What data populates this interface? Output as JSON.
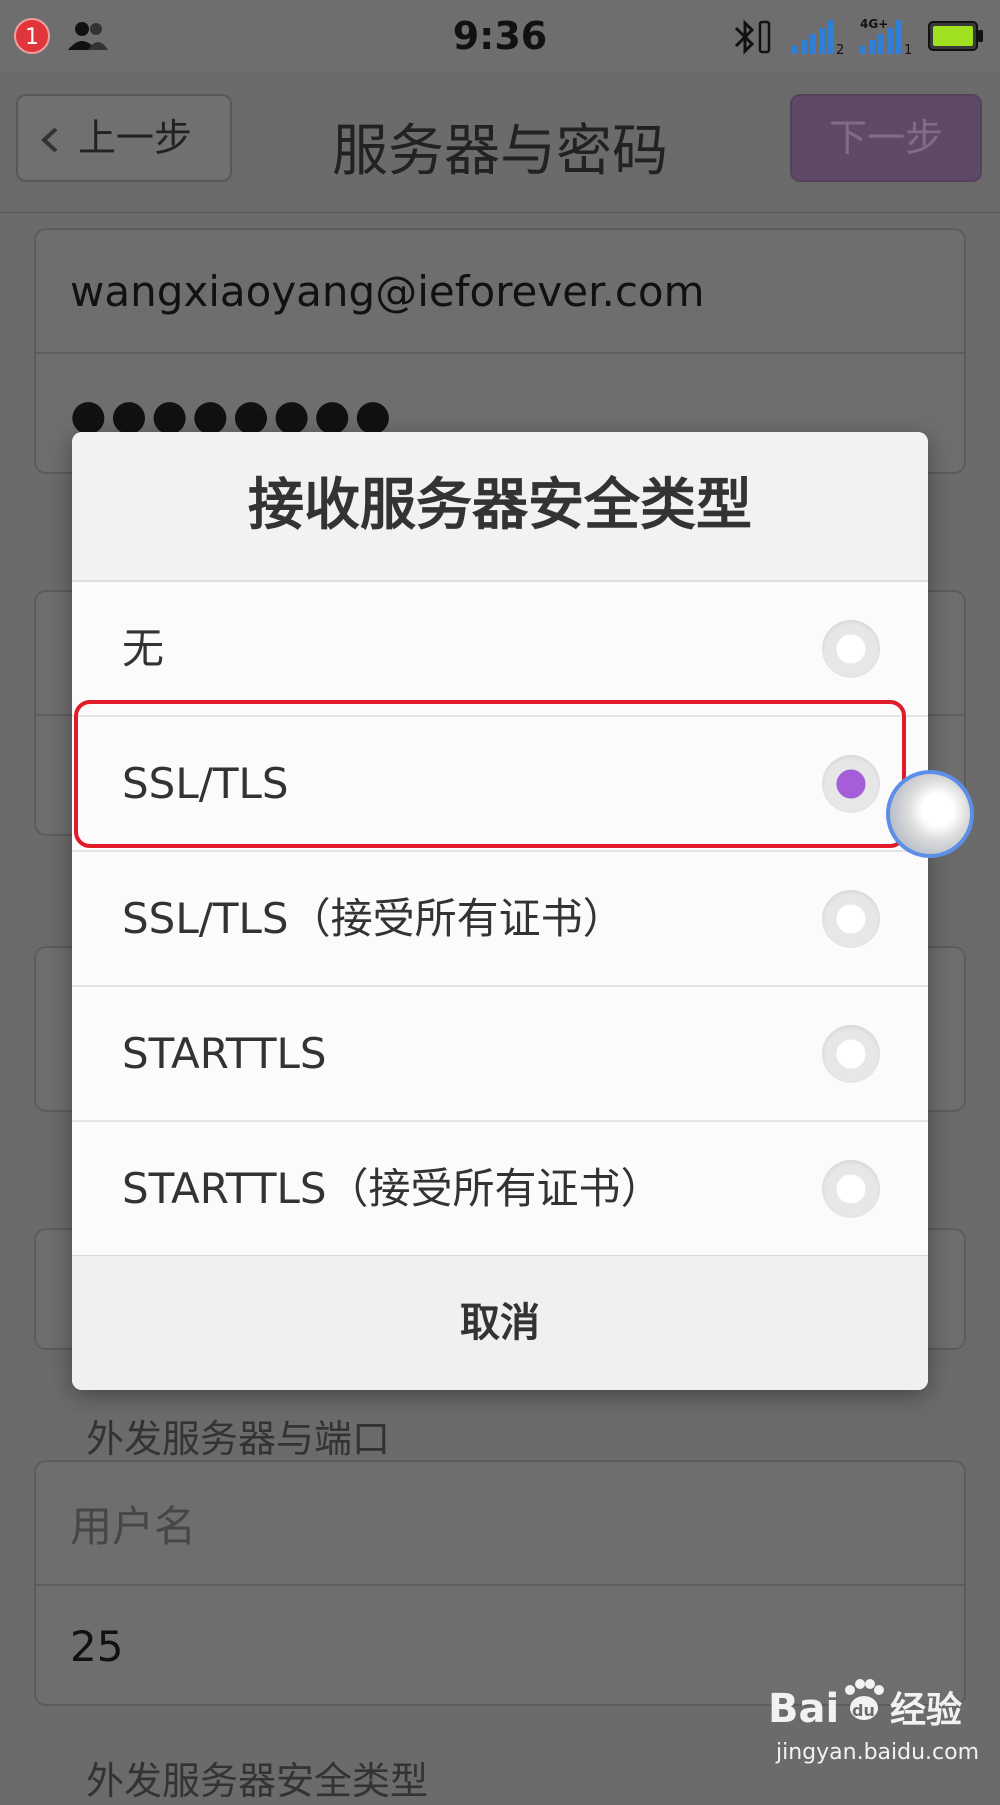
{
  "status_bar": {
    "notification_count": "1",
    "time": "9:36",
    "network_label": "4G+",
    "sim1": "2",
    "sim2": "1",
    "icons": [
      "people-icon",
      "bluetooth-icon",
      "signal-icon",
      "battery-icon"
    ]
  },
  "nav": {
    "back_label": "上一步",
    "title": "服务器与密码",
    "next_label": "下一步"
  },
  "form": {
    "email": "wangxiaoyang@ieforever.com",
    "password_mask": "●●●●●●●●",
    "outgoing_section_label": "外发服务器与端口",
    "username_placeholder": "用户名",
    "port": "25",
    "outgoing_security_label": "外发服务器安全类型"
  },
  "dialog": {
    "title": "接收服务器安全类型",
    "options": [
      {
        "label": "无",
        "checked": false
      },
      {
        "label": "SSL/TLS",
        "checked": true
      },
      {
        "label": "SSL/TLS（接受所有证书）",
        "checked": false
      },
      {
        "label": "STARTTLS",
        "checked": false
      },
      {
        "label": "STARTTLS（接受所有证书）",
        "checked": false
      }
    ],
    "cancel_label": "取消"
  },
  "watermark": {
    "brand_bai": "Bai",
    "brand_du": "du",
    "brand_suffix": "经验",
    "url": "jingyan.baidu.com"
  },
  "colors": {
    "accent_purple": "#a65ed8",
    "highlight_red": "#e01b2a",
    "scrim_gray": "#6b6b6b"
  }
}
